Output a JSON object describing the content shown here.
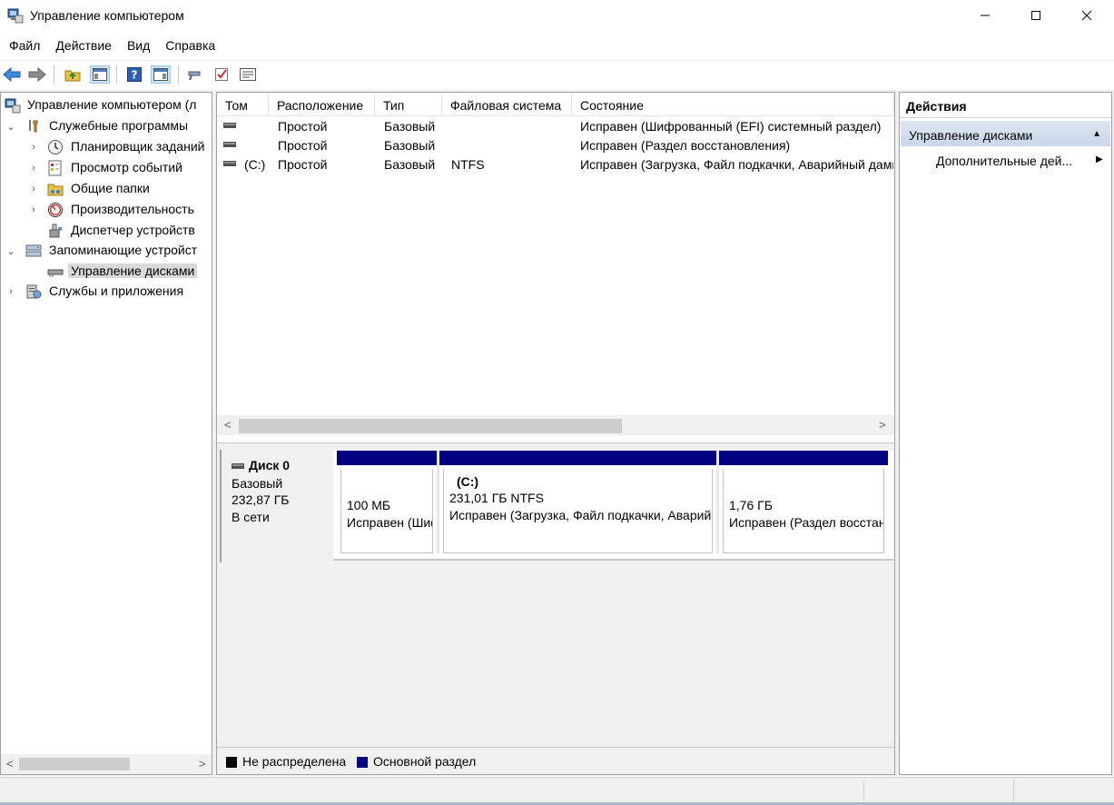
{
  "window": {
    "title": "Управление компьютером",
    "minimize_glyph": "—",
    "maximize_glyph": "☐",
    "close_glyph": "✕"
  },
  "menu": [
    "Файл",
    "Действие",
    "Вид",
    "Справка"
  ],
  "toolbar": {
    "icons": [
      "back-icon",
      "forward-icon",
      "up-folder-icon",
      "show-tree-icon",
      "help-icon",
      "show-action-pane-icon",
      "connect-icon",
      "check-icon",
      "properties-icon"
    ]
  },
  "tree": {
    "items": [
      {
        "label": "Управление компьютером (л",
        "icon": "computer-management-icon",
        "level": 0,
        "expander": ""
      },
      {
        "label": "Служебные программы",
        "icon": "tools-icon",
        "level": 1,
        "expander": "⌄"
      },
      {
        "label": "Планировщик заданий",
        "icon": "clock-icon",
        "level": 2,
        "expander": "›"
      },
      {
        "label": "Просмотр событий",
        "icon": "event-viewer-icon",
        "level": 2,
        "expander": "›"
      },
      {
        "label": "Общие папки",
        "icon": "shared-folders-icon",
        "level": 2,
        "expander": "›"
      },
      {
        "label": "Производительность",
        "icon": "performance-icon",
        "level": 2,
        "expander": "›"
      },
      {
        "label": "Диспетчер устройств",
        "icon": "device-manager-icon",
        "level": 2,
        "expander": ""
      },
      {
        "label": "Запоминающие устройст",
        "icon": "storage-icon",
        "level": 1,
        "expander": "⌄"
      },
      {
        "label": "Управление дисками",
        "icon": "disk-management-icon",
        "level": 2,
        "expander": "",
        "selected": true
      },
      {
        "label": "Службы и приложения",
        "icon": "services-icon",
        "level": 1,
        "expander": "›"
      }
    ],
    "scroll_left": "<",
    "scroll_right": ">"
  },
  "volumes": {
    "columns": [
      "Том",
      "Расположение",
      "Тип",
      "Файловая система",
      "Состояние"
    ],
    "rows": [
      {
        "tom": "",
        "location": "Простой",
        "type": "Базовый",
        "fs": "",
        "state": "Исправен (Шифрованный (EFI) системный раздел)"
      },
      {
        "tom": "",
        "location": "Простой",
        "type": "Базовый",
        "fs": "",
        "state": "Исправен (Раздел восстановления)"
      },
      {
        "tom": "(C:)",
        "location": "Простой",
        "type": "Базовый",
        "fs": "NTFS",
        "state": "Исправен (Загрузка, Файл подкачки, Аварийный дамп памяти, Основной раздел)"
      }
    ],
    "scroll_left": "<",
    "scroll_right": ">"
  },
  "disk": {
    "name": "Диск 0",
    "kind": "Базовый",
    "size": "232,87 ГБ",
    "status": "В сети",
    "partitions": [
      {
        "title": "",
        "size": "100 МБ",
        "state": "Исправен (Шифрованный (EFI) системный раздел)"
      },
      {
        "title": "(C:)",
        "size": "231,01 ГБ NTFS",
        "state": "Исправен (Загрузка, Файл подкачки, Аварийный дамп памяти, Основной раздел)"
      },
      {
        "title": "",
        "size": "1,76 ГБ",
        "state": "Исправен (Раздел восстановления)"
      }
    ]
  },
  "legend": [
    {
      "label": "Не распределена",
      "color": "#000000"
    },
    {
      "label": "Основной раздел",
      "color": "#000080"
    }
  ],
  "actions": {
    "header": "Действия",
    "group": "Управление дисками",
    "item": "Дополнительные дей..."
  }
}
